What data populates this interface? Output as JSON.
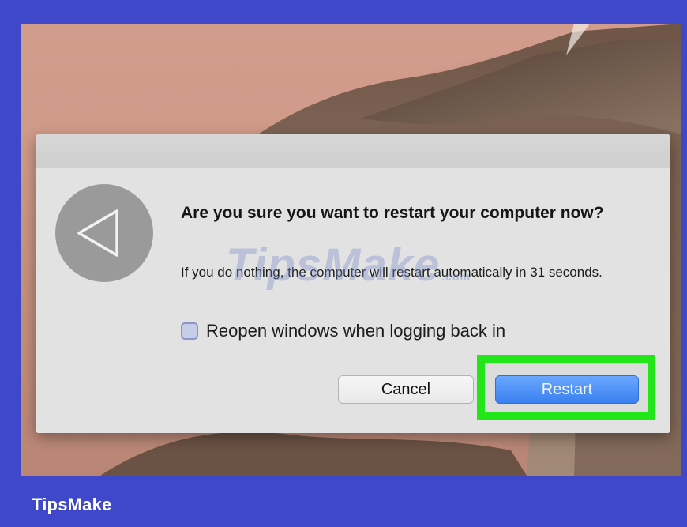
{
  "dialog": {
    "headline": "Are you sure you want to restart your computer now?",
    "message": "If you do nothing, the computer will restart automatically in 31 seconds.",
    "checkbox_label": "Reopen windows when logging back in",
    "checkbox_checked": false,
    "cancel_label": "Cancel",
    "restart_label": "Restart",
    "icon": "back-triangle-icon"
  },
  "watermark": {
    "text": "TipsMake",
    "suffix": ".com"
  },
  "footer": {
    "brand": "TipsMake"
  },
  "colors": {
    "frame": "#3f48c8",
    "highlight": "#22e61a",
    "primary_button": "#3a80f0"
  }
}
